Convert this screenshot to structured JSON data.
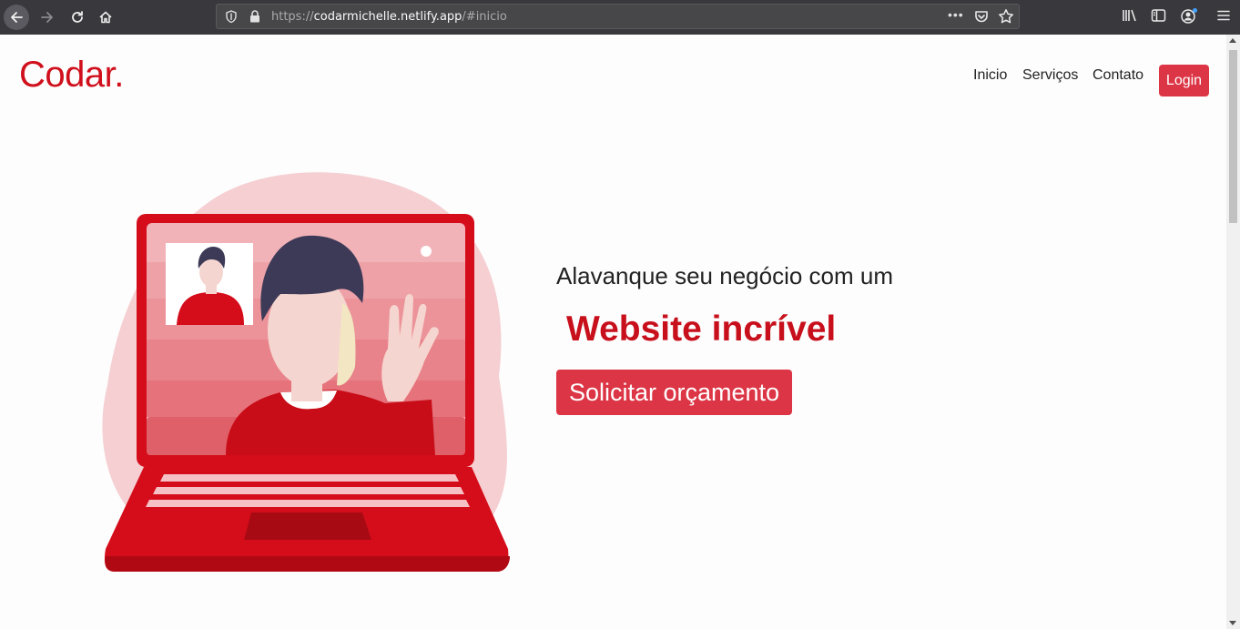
{
  "browser": {
    "url_scheme": "https://",
    "url_host": "codarmichelle.netlify.app",
    "url_path": "/#inicio",
    "page_actions": "•••"
  },
  "site": {
    "logo": "Codar.",
    "nav": [
      "Inicio",
      "Serviços",
      "Contato"
    ],
    "login_label": "Login"
  },
  "hero": {
    "subtitle": "Alavanque seu negócio com um",
    "title": "Website incrível",
    "cta_label": "Solicitar orçamento"
  },
  "colors": {
    "brand_red": "#d0101c",
    "button_red": "#dc3545",
    "chrome_bg": "#38383d"
  },
  "icons": {
    "back": "back-arrow-icon",
    "forward": "forward-arrow-icon",
    "reload": "reload-icon",
    "home": "home-icon",
    "shield": "shield-icon",
    "lock": "lock-icon",
    "pocket": "pocket-icon",
    "star": "bookmark-star-icon",
    "library": "library-icon",
    "sidebar": "sidebar-icon",
    "account": "account-icon",
    "menu": "hamburger-menu-icon"
  }
}
